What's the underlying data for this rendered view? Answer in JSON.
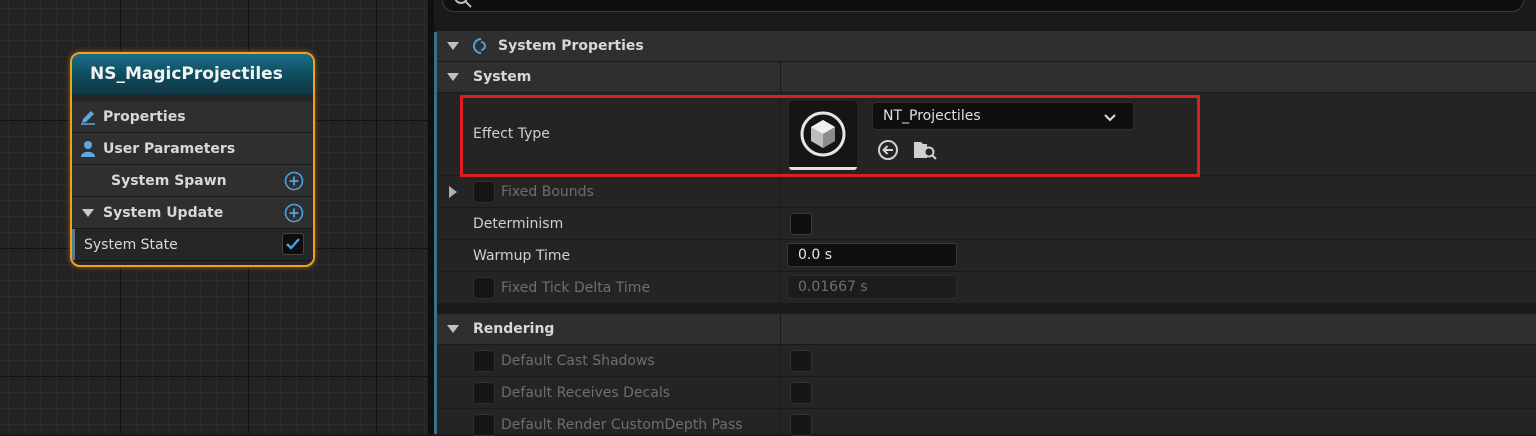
{
  "graph": {
    "node": {
      "title": "NS_MagicProjectiles",
      "rows": [
        {
          "label": "Properties",
          "icon": "pencil-icon"
        },
        {
          "label": "User Parameters",
          "icon": "user-icon"
        },
        {
          "label": "System Spawn",
          "icon": "add-icon"
        },
        {
          "label": "System Update",
          "icon": "add-icon"
        },
        {
          "label": "System State",
          "checked": true
        }
      ]
    }
  },
  "details": {
    "root_header": "System Properties",
    "sections": {
      "system": {
        "title": "System",
        "effect_type": {
          "label": "Effect Type",
          "value": "NT_Projectiles",
          "icons": [
            "cube-icon",
            "browse-back-icon",
            "find-in-folder-icon"
          ]
        },
        "fixed_bounds": "Fixed Bounds",
        "determinism": "Determinism",
        "warmup_time": {
          "label": "Warmup Time",
          "value": "0.0 s"
        },
        "fixed_tick": {
          "label": "Fixed Tick Delta Time",
          "value": "0.01667 s"
        }
      },
      "rendering": {
        "title": "Rendering",
        "cast_shadows": "Default Cast Shadows",
        "receives_decals": "Default Receives Decals",
        "custom_depth": "Default Render CustomDepth Pass"
      }
    }
  },
  "colors": {
    "node_border": "#f0a020",
    "node_title": "#1a6e86",
    "highlight": "#dc1e1e",
    "accent": "#3c6d8a",
    "plus_icon": "#4aa3df"
  }
}
